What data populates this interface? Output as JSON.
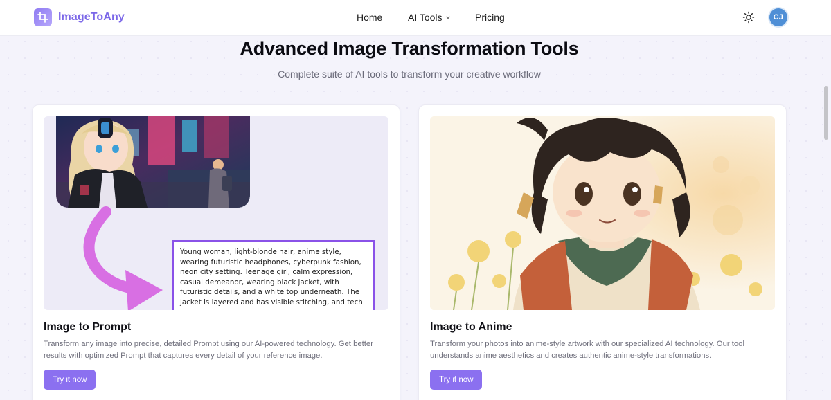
{
  "app": {
    "name": "ImageToAny"
  },
  "nav": {
    "home": "Home",
    "ai_tools": "AI Tools",
    "pricing": "Pricing"
  },
  "user": {
    "initials": "CJ"
  },
  "hero": {
    "title": "Advanced Image Transformation Tools",
    "subtitle": "Complete suite of AI tools to transform your creative workflow"
  },
  "cards": [
    {
      "title": "Image to Prompt",
      "description": "Transform any image into precise, detailed Prompt using our AI-powered technology. Get better results with optimized Prompt that captures every detail of your reference image.",
      "button": "Try it now",
      "prompt_text": "Young woman, light-blonde hair, anime style, wearing futuristic headphones, cyberpunk fashion, neon city setting. Teenage girl, calm expression, casual demeanor, wearing black jacket, with futuristic details, and a white top underneath. The jacket is layered and has visible stitching, and tech"
    },
    {
      "title": "Image to Anime",
      "description": "Transform your photos into anime-style artwork with our specialized AI technology. Our tool understands anime aesthetics and creates authentic anime-style transformations.",
      "button": "Try it now"
    }
  ],
  "colors": {
    "accent": "#8b70f0",
    "brand_text": "#7b67e8",
    "avatar_bg": "#4f8fd6",
    "prompt_border": "#8a52e8",
    "arrow": "#d86fe3"
  },
  "icons": {
    "logo": "crop-icon",
    "nav_dropdown": "chevron-down-icon",
    "theme_toggle": "sun-icon"
  }
}
